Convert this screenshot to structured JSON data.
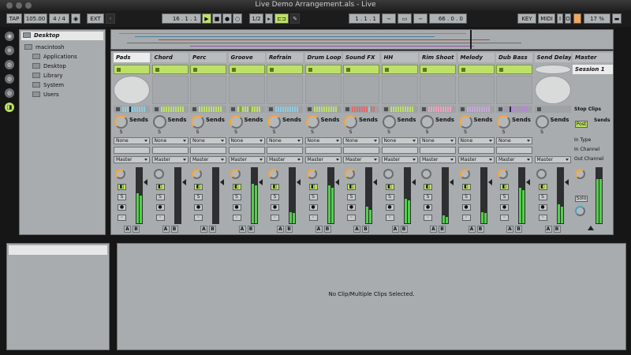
{
  "window": {
    "title": "Live Demo Arrangement.als - Live"
  },
  "transport": {
    "tap": "TAP",
    "tempo": "105.00",
    "signature": "4 / 4",
    "ext": "EXT",
    "position": "16 .  1 .  1",
    "quantize": "1/2",
    "loop_start": "1 .  1 .  1",
    "loop_length": "66 .  0 .  0",
    "key": "KEY",
    "midi": "MIDI",
    "cpu": "17 %",
    "in": "I",
    "o": "O"
  },
  "browser": {
    "items": [
      {
        "label": "Desktop",
        "selected": true
      },
      {
        "label": "macintosh",
        "selected": false
      },
      {
        "label": "Applications",
        "selected": false
      },
      {
        "label": "Desktop",
        "selected": false
      },
      {
        "label": "Library",
        "selected": false
      },
      {
        "label": "System",
        "selected": false
      },
      {
        "label": "Users",
        "selected": false
      }
    ]
  },
  "mixer": {
    "sends_label": "Sends",
    "send_s": "S",
    "tracks": [
      {
        "name": "Pads",
        "selected": true,
        "input": "None",
        "output": "Master",
        "clip_fill": 0.7,
        "vol": 0.55,
        "vol2": 0.5,
        "pan_orange": true,
        "clip_slot_light": true,
        "meter_colors": [
          "#8ecbe0",
          "#8ecbe0",
          "#8ecbe0",
          "#2b2b2b",
          "#8ecbe0",
          "#8ecbe0",
          "#8ecbe0",
          "#8ecbe0",
          "#8ecbe0",
          "#8ecbe0"
        ]
      },
      {
        "name": "Chord",
        "selected": false,
        "input": "None",
        "output": "Master",
        "clip_fill": 0.7,
        "vol": 0.0,
        "vol2": 0.0,
        "pan_orange": false,
        "clip_slot_light": false,
        "meter_colors": [
          "#bde067",
          "#bde067",
          "#bde067",
          "#bde067",
          "#bde067",
          "#bde067",
          "#bde067",
          "#bde067",
          "#bde067",
          "#bde067"
        ]
      },
      {
        "name": "Perc",
        "selected": false,
        "input": "None",
        "output": "Master",
        "clip_fill": 0.7,
        "vol": 0.0,
        "vol2": 0.0,
        "pan_orange": true,
        "clip_slot_light": false,
        "meter_colors": [
          "#bde067",
          "#bde067",
          "#bde067",
          "#bde067",
          "#bde067",
          "#bde067",
          "#bde067",
          "#bde067",
          "#bde067",
          "#bde067"
        ]
      },
      {
        "name": "Groove",
        "selected": false,
        "input": "None",
        "output": "Master",
        "clip_fill": 0.7,
        "vol": 0.72,
        "vol2": 0.68,
        "pan_orange": true,
        "clip_slot_light": false,
        "meter_colors": [
          "#bde067",
          "#7fa83a",
          "#bde067",
          "#bde067",
          "#bde067",
          "#7fa83a",
          "#bde067",
          "#bde067",
          "#bde067",
          "#bde067"
        ]
      },
      {
        "name": "Refrain",
        "selected": false,
        "input": "None",
        "output": "Master",
        "clip_fill": 0.7,
        "vol": 0.2,
        "vol2": 0.18,
        "pan_orange": true,
        "clip_slot_light": false,
        "meter_colors": [
          "#8ecbe0",
          "#8ecbe0",
          "#8ecbe0",
          "#8ecbe0",
          "#8ecbe0",
          "#8ecbe0",
          "#8ecbe0",
          "#8ecbe0",
          "#8ecbe0",
          "#8ecbe0"
        ]
      },
      {
        "name": "Drum Loop",
        "selected": false,
        "input": "None",
        "output": "Master",
        "clip_fill": 0.7,
        "vol": 0.68,
        "vol2": 0.65,
        "pan_orange": true,
        "clip_slot_light": false,
        "meter_colors": [
          "#bde067",
          "#bde067",
          "#bde067",
          "#bde067",
          "#bde067",
          "#bde067",
          "#bde067",
          "#bde067",
          "#bde067",
          "#bde067"
        ]
      },
      {
        "name": "Sound FX",
        "selected": false,
        "input": "None",
        "output": "Master",
        "clip_fill": 0.7,
        "vol": 0.3,
        "vol2": 0.25,
        "pan_orange": true,
        "clip_slot_light": false,
        "meter_colors": [
          "#e06b6b",
          "#e06b6b",
          "#e06b6b",
          "#e06b6b",
          "#e06b6b",
          "#e06b6b",
          "#e06b6b",
          "#8ecbe0",
          "#e06b6b",
          "#e06b6b"
        ]
      },
      {
        "name": "HH",
        "selected": false,
        "input": "None",
        "output": "Master",
        "clip_fill": 0.7,
        "vol": 0.45,
        "vol2": 0.42,
        "pan_orange": false,
        "clip_slot_light": false,
        "meter_colors": [
          "#bde067",
          "#bde067",
          "#bde067",
          "#bde067",
          "#bde067",
          "#bde067",
          "#bde067",
          "#bde067",
          "#bde067",
          "#bde067"
        ]
      },
      {
        "name": "Rim Shoot",
        "selected": false,
        "input": "None",
        "output": "Master",
        "clip_fill": 0.7,
        "vol": 0.15,
        "vol2": 0.12,
        "pan_orange": false,
        "clip_slot_light": false,
        "meter_colors": [
          "#f0a0b8",
          "#f0a0b8",
          "#f0a0b8",
          "#f0a0b8",
          "#f0a0b8",
          "#f0a0b8",
          "#f0a0b8",
          "#f0a0b8",
          "#f0a0b8",
          "#f0a0b8"
        ]
      },
      {
        "name": "Melody",
        "selected": false,
        "input": "None",
        "output": "Master",
        "clip_fill": 0.7,
        "vol": 0.2,
        "vol2": 0.18,
        "pan_orange": true,
        "clip_slot_light": false,
        "meter_colors": [
          "#c8a8d8",
          "#c8a8d8",
          "#c8a8d8",
          "#c8a8d8",
          "#c8a8d8",
          "#c8a8d8",
          "#c8a8d8",
          "#c8a8d8",
          "#c8a8d8",
          "#c8a8d8"
        ]
      },
      {
        "name": "Dub Bass",
        "selected": false,
        "input": "None",
        "output": "Master",
        "clip_fill": 0.7,
        "vol": 0.65,
        "vol2": 0.6,
        "pan_orange": true,
        "clip_slot_light": false,
        "meter_colors": [
          "#b08ad0",
          "#b08ad0",
          "#2b2b2b",
          "#b08ad0",
          "#b08ad0",
          "#b08ad0",
          "#b08ad0",
          "#b08ad0",
          "#b08ad0",
          "#b08ad0"
        ]
      },
      {
        "name": "Send Delay",
        "selected": false,
        "input": "",
        "output": "Master",
        "clip_fill": 0,
        "vol": 0.35,
        "vol2": 0.3,
        "pan_orange": false,
        "clip_slot_light": true,
        "meter_colors": []
      }
    ],
    "master": {
      "name": "Master",
      "scene": "Session 1",
      "stop_clips": "Stop Clips",
      "post": "Post",
      "sends": "Sends",
      "in_type": "In Type",
      "in_channel": "In Channel",
      "out_channel": "Out Channel",
      "solo": "Solo",
      "vol": 0.8
    }
  },
  "detail": {
    "message": "No Clip/Multiple Clips Selected."
  },
  "colors": {
    "accent": "#bde067",
    "panel": "#a8acae",
    "knob_accent": "#f5a43c",
    "meter": "#52d04a"
  }
}
